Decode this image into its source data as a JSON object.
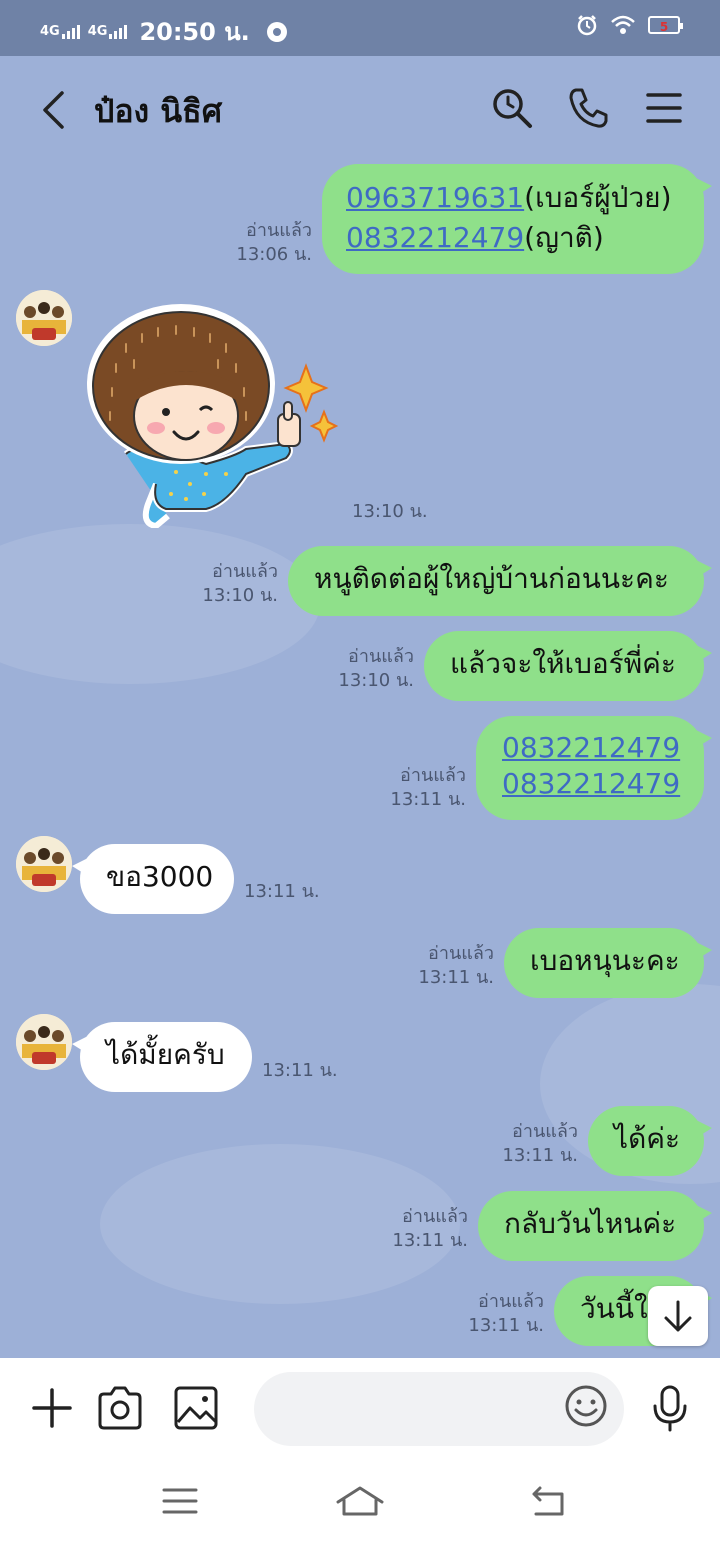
{
  "status_bar": {
    "signal1": "4G",
    "signal2": "4G",
    "time": "20:50 น.",
    "battery": "5"
  },
  "header": {
    "title": "ป๋อง นิธิศ"
  },
  "messages": [
    {
      "dir": "out",
      "lines": [
        {
          "link": "0963719631",
          "text": "(เบอร์ผู้ป่วย)"
        },
        {
          "link": "0832212479",
          "text": "(ญาติ)"
        }
      ],
      "read": "อ่านแล้ว",
      "time": "13:06 น."
    },
    {
      "dir": "in",
      "sticker": "thumbs-up-girl-sticker",
      "time": "13:10 น."
    },
    {
      "dir": "out",
      "text": "หนูติดต่อผู้ใหญ่บ้านก่อนนะคะ",
      "read": "อ่านแล้ว",
      "time": "13:10 น."
    },
    {
      "dir": "out",
      "text": "แล้วจะให้เบอร์พี่ค่ะ",
      "read": "อ่านแล้ว",
      "time": "13:10 น."
    },
    {
      "dir": "out",
      "lines": [
        {
          "link": "0832212479"
        },
        {
          "link": "0832212479"
        }
      ],
      "read": "อ่านแล้ว",
      "time": "13:11 น."
    },
    {
      "dir": "in",
      "text": "ขอ3000",
      "time": "13:11 น."
    },
    {
      "dir": "out",
      "text": "เบอหนุนะคะ",
      "read": "อ่านแล้ว",
      "time": "13:11 น."
    },
    {
      "dir": "in",
      "text": "ได้มั้ยครับ",
      "time": "13:11 น."
    },
    {
      "dir": "out",
      "text": "ได้ค่ะ",
      "read": "อ่านแล้ว",
      "time": "13:11 น."
    },
    {
      "dir": "out",
      "text": "กลับวันไหนค่ะ",
      "read": "อ่านแล้ว",
      "time": "13:11 น."
    },
    {
      "dir": "out",
      "text": "วันนี้ใ",
      "read": "อ่านแล้ว",
      "time": "13:11 น."
    }
  ],
  "input": {
    "placeholder": ""
  },
  "colors": {
    "chat_bg": "#9db0d7",
    "out_bubble": "#8fe08a",
    "in_bubble": "#ffffff",
    "link": "#3f6ac4",
    "status_bar": "#6f82a6"
  }
}
